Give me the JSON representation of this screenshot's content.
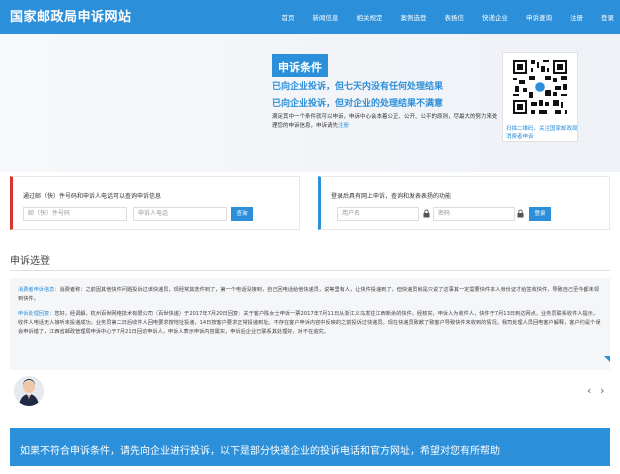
{
  "header": {
    "site_title": "国家邮政局申诉网站",
    "nav": [
      "首页",
      "新闻信息",
      "相关规定",
      "案例选登",
      "表扬信",
      "快递企业",
      "申诉查询",
      "注册",
      "登录"
    ]
  },
  "hero": {
    "title": "申诉条件",
    "condition_1": "已向企业投诉，但七天内没有任何处理结果",
    "condition_2": "已向企业投诉，但对企业的处理结果不满意",
    "note": "满足其中一个条件就可以申诉，申诉中心会本着公正、公开、公平的原则，尽最大的努力来处理您的申诉信息，申诉请先",
    "note_link": "注册",
    "qr_caption": "扫描二维码，关注国家邮政局消费者申诉"
  },
  "query_left": {
    "label": "通过邮（快）件号码和申诉人电话可以查询申诉信息",
    "mail_placeholder": "邮（快）件号码",
    "phone_placeholder": "申诉人电话",
    "button": "查询"
  },
  "query_right": {
    "label": "登录后具有网上申诉，查询和发表表扬的功能",
    "user_placeholder": "用户名",
    "pass_placeholder": "密码",
    "button": "登录"
  },
  "section": {
    "title": "申诉选登",
    "p1_tag": "消费者申诉信息：",
    "p1": "消费者称：之前因其他快件问题投诉过该快递员，现经常其迭件到了，第一个电话没接到，自己回电话给他快递员，说等里有人，让快件投递到了，但快递员就是只说了这事其一定需要快件本人身份证才给签收快件，导致自己至今都未领到快件。",
    "p2_tag": "申诉处理回复：",
    "p2": "您好，经调解，杭州百世网络技术有限公司（百世快递）于2017年7月20日回复：关于客户陈女士申诉一票2017年7月11日从浙江义乌发往江西新余的快件，经核实，申诉人为收件人，快件于7月13日到达网点，业务员联系收件人提示，收件人电话无人接听未投递成功，业务员第二日后收件人回电要求按地址投递，14日按客户要求正常投递到址。不存在客户申诉内容中反映的之前投诉过快递员。现在快递员致歉了致客户导致快件未收到的情况，我司处理人员回电客户解释，客户约是个误会申诉错了，江西省邮政管理局申诉中心于7月21日回访申诉人，申诉人表示申诉内容属实，申诉后企业已联系其处理好，对不在追究。"
  },
  "banner": {
    "text": "如果不符合申诉条件，请先向企业进行投诉，以下是部分快递企业的投诉电话和官方网址，希望对您有所帮助"
  },
  "icons": {
    "lock": "lock-icon",
    "avatar": "avatar",
    "prev": "chevron-left-icon",
    "next": "chevron-right-icon"
  },
  "colors": {
    "primary": "#2b8fd9",
    "accent_red": "#d9332b"
  },
  "carousel": {
    "prev": "‹",
    "next": "›"
  }
}
